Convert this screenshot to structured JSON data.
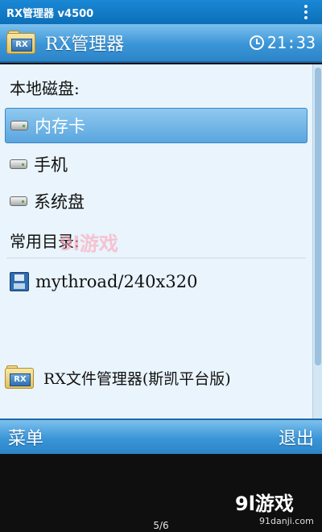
{
  "statusbar": {
    "title": "RX管理器 v4500"
  },
  "app": {
    "title": "RX管理器",
    "time": "21:33"
  },
  "content": {
    "local_disks_heading": "本地磁盘:",
    "items": [
      {
        "label": "内存卡",
        "selected": true
      },
      {
        "label": "手机",
        "selected": false
      },
      {
        "label": "系统盘",
        "selected": false
      }
    ],
    "common_dirs_heading": "常用目录:",
    "common_dir": "mythroad/240x320",
    "footer_label": "RX文件管理器(斯凯平台版)"
  },
  "softkeys": {
    "left": "菜单",
    "right": "退出"
  },
  "gallery": {
    "counter": "5/6",
    "watermark_logo": "9l游戏",
    "watermark_url": "91danji.com"
  },
  "overlay": {
    "center_watermark": "9l游戏"
  },
  "colors": {
    "accent": "#2c84c8",
    "selection": "#5aa6df",
    "background": "#e9f4fc"
  },
  "icons": {
    "menu": "overflow-dots-icon",
    "clock": "clock-icon",
    "drive": "drive-icon",
    "floppy": "floppy-icon",
    "folder": "rx-folder-icon"
  }
}
